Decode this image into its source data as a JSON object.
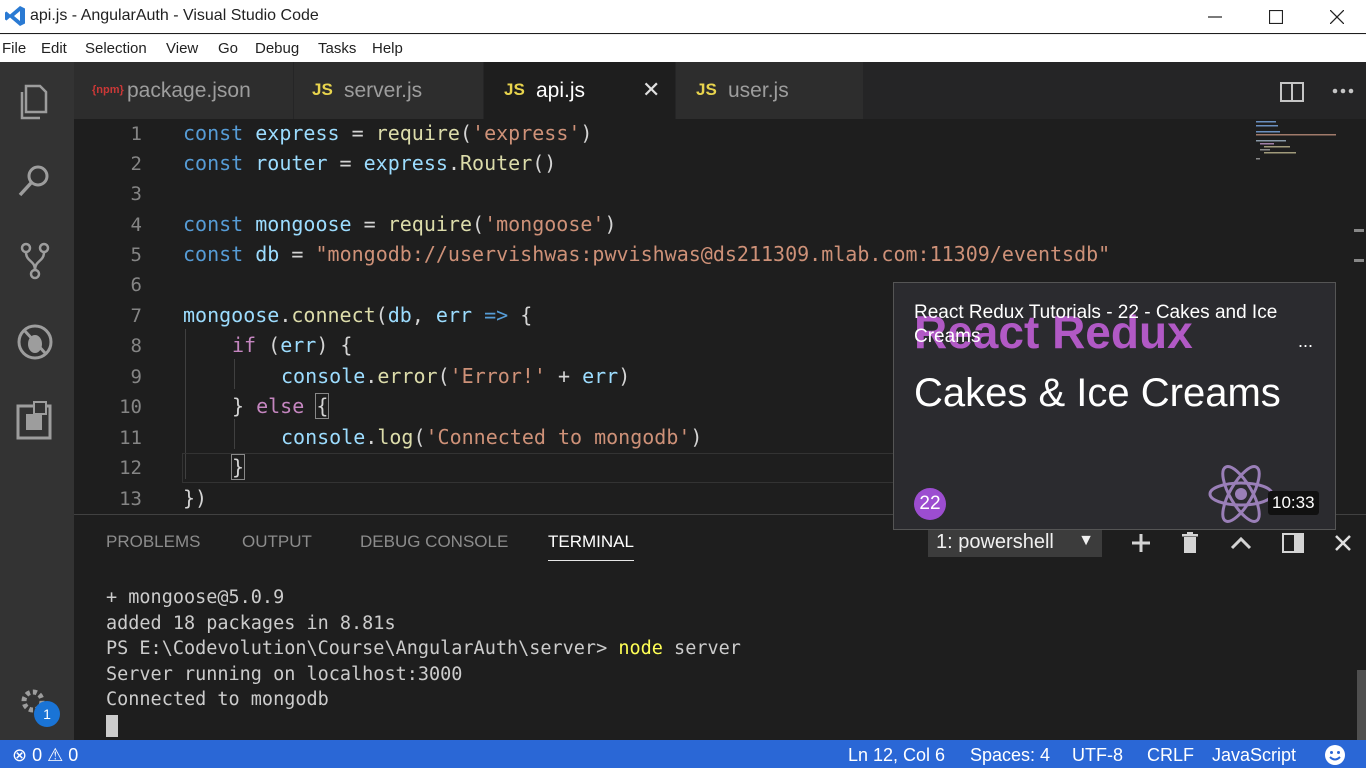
{
  "window": {
    "title": "api.js - AngularAuth - Visual Studio Code"
  },
  "menu": [
    "File",
    "Edit",
    "Selection",
    "View",
    "Go",
    "Debug",
    "Tasks",
    "Help"
  ],
  "tabs": [
    {
      "icon": "npm-icon",
      "icon_text": "{npm}",
      "label": "package.json"
    },
    {
      "icon": "js-icon",
      "icon_text": "JS",
      "label": "server.js"
    },
    {
      "icon": "js-icon",
      "icon_text": "JS",
      "label": "api.js",
      "close": "✕"
    },
    {
      "icon": "js-icon",
      "icon_text": "JS",
      "label": "user.js"
    }
  ],
  "editor": {
    "line_numbers": [
      "1",
      "2",
      "3",
      "4",
      "5",
      "6",
      "7",
      "8",
      "9",
      "10",
      "11",
      "12",
      "13"
    ],
    "code": {
      "l1": {
        "kw": "const",
        "var": "express",
        "eq": " = ",
        "fn": "require",
        "open": "(",
        "str": "'express'",
        "close": ")"
      },
      "l2": {
        "kw": "const",
        "var": "router",
        "eq": " = ",
        "obj": "express",
        "dot": ".",
        "fn": "Router",
        "tail": "()"
      },
      "l4": {
        "kw": "const",
        "var": "mongoose",
        "eq": " = ",
        "fn": "require",
        "open": "(",
        "str": "'mongoose'",
        "close": ")"
      },
      "l5": {
        "kw": "const",
        "var": "db",
        "eq": " = ",
        "str": "\"mongodb://uservishwas:pwvishwas@ds211309.mlab.com:11309/eventsdb\""
      },
      "l7": {
        "obj": "mongoose",
        "dot": ".",
        "fn": "connect",
        "open": "(",
        "a1": "db",
        "comma": ", ",
        "a2": "err",
        "arrow": " => ",
        "brace": "{"
      },
      "l8": {
        "ctl": "if",
        "open": " (",
        "var": "err",
        "close": ") {"
      },
      "l9": {
        "obj": "console",
        "dot": ".",
        "fn": "error",
        "open": "(",
        "str": "'Error!'",
        "plus": " + ",
        "var": "err",
        "close": ")"
      },
      "l10": {
        "b": "} ",
        "ctl": "else",
        "sp": " ",
        "brace": "{"
      },
      "l11": {
        "obj": "console",
        "dot": ".",
        "fn": "log",
        "open": "(",
        "str": "'Connected to mongodb'",
        "close": ")"
      },
      "l12": {
        "brace": "}"
      },
      "l13": {
        "close": "})"
      }
    }
  },
  "video": {
    "title": "React Redux Tutorials - 22 - Cakes and Ice Creams",
    "thumb_title": "React Redux",
    "thumb_subtitle": "Cakes & Ice Creams",
    "episode": "22",
    "duration": "10:33",
    "more": "..."
  },
  "panel": {
    "tabs": [
      "PROBLEMS",
      "OUTPUT",
      "DEBUG CONSOLE",
      "TERMINAL"
    ],
    "active_tab": "TERMINAL",
    "terminal_select": "1: powershell",
    "terminal_lines": [
      "+ mongoose@5.0.9",
      "added 18 packages in 8.81s",
      "PS E:\\Codevolution\\Course\\AngularAuth\\server> ",
      "Server running on localhost:3000",
      "Connected to mongodb"
    ],
    "command": {
      "cmd": "node",
      "arg": " server"
    }
  },
  "activity": {
    "badge": "1"
  },
  "status": {
    "errors": "0",
    "warnings": "0",
    "position": "Ln 12, Col 6",
    "spaces": "Spaces: 4",
    "encoding": "UTF-8",
    "eol": "CRLF",
    "language": "JavaScript"
  },
  "colors": {
    "accent": "#2a67d6",
    "activity_bar": "#333333",
    "editor_bg": "#1e1e1e"
  }
}
